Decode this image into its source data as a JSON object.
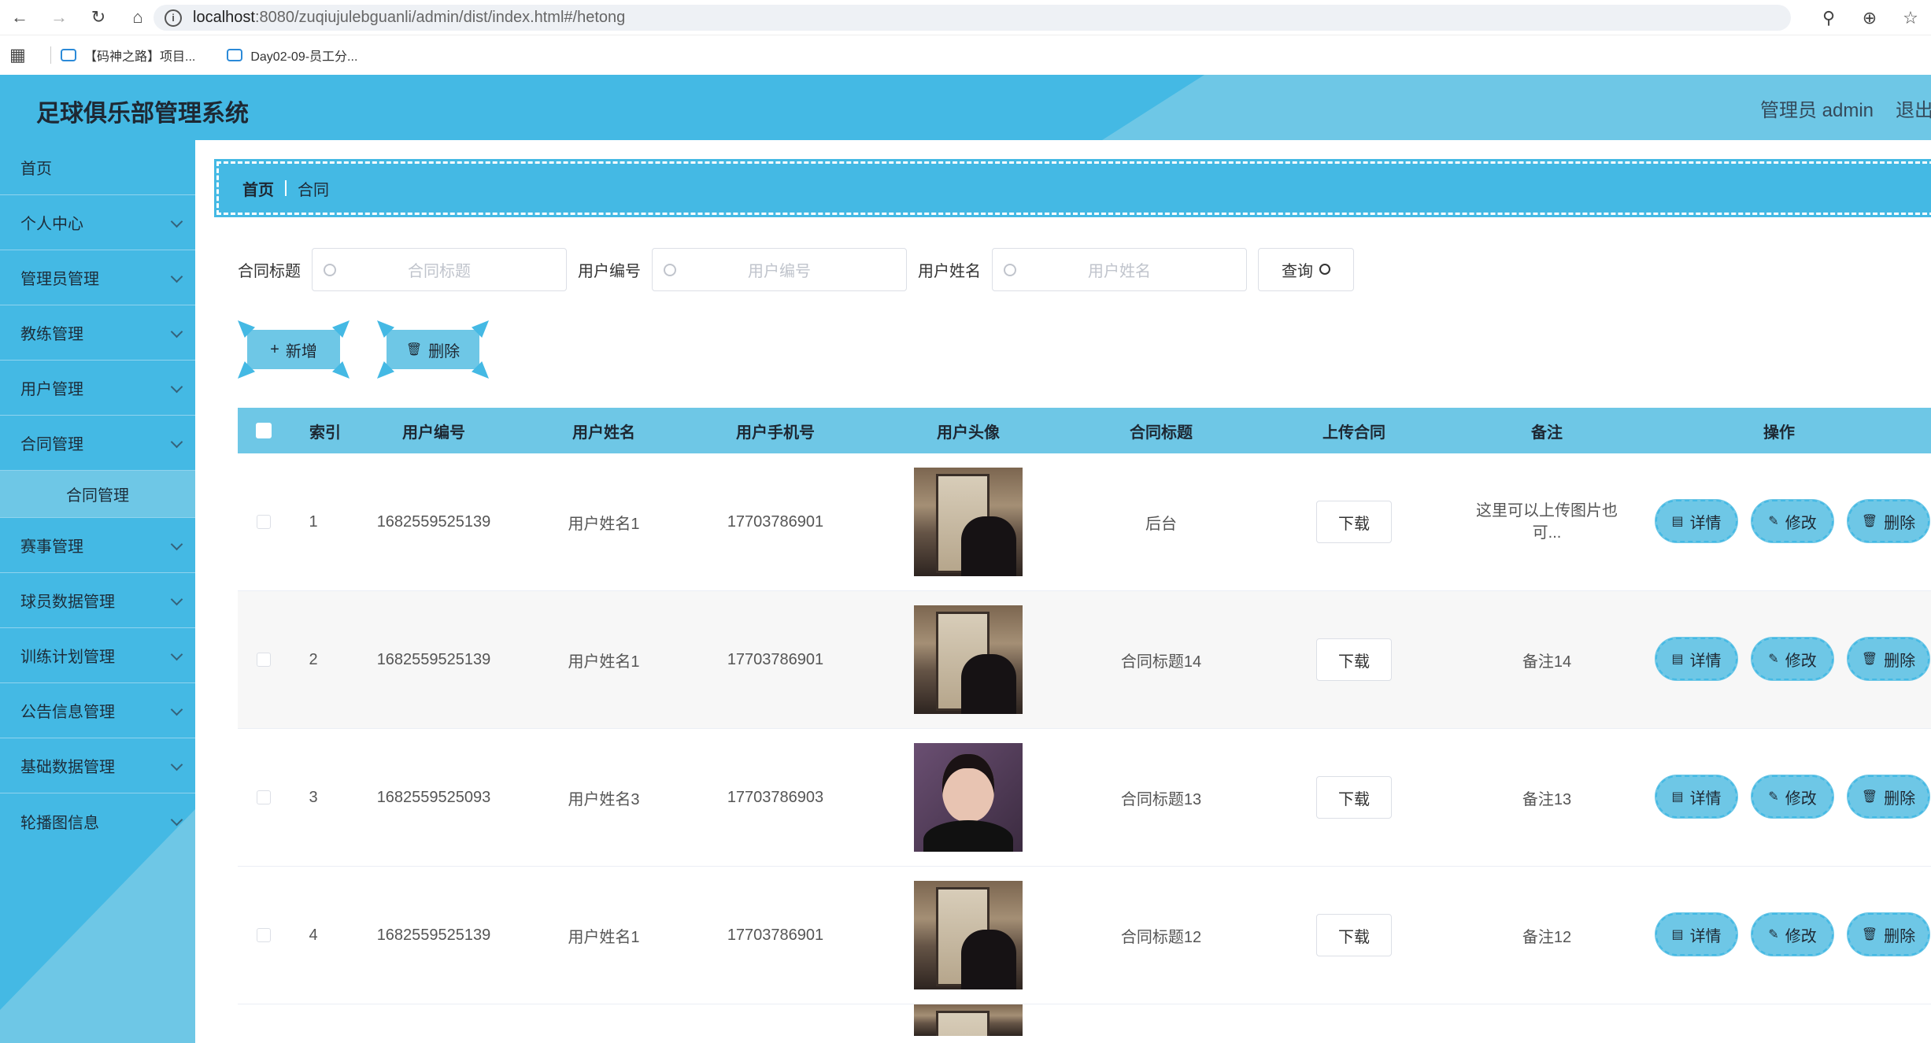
{
  "browser": {
    "url_host": "localhost",
    "url_rest": ":8080/zuqiujulebguanli/admin/dist/index.html#/hetong",
    "bookmarks": [
      "【码神之路】项目...",
      "Day02-09-员工分..."
    ]
  },
  "header": {
    "title": "足球俱乐部管理系统",
    "user": "管理员 admin",
    "logout": "退出"
  },
  "sidebar": {
    "items": [
      {
        "label": "首页"
      },
      {
        "label": "个人中心"
      },
      {
        "label": "管理员管理"
      },
      {
        "label": "教练管理"
      },
      {
        "label": "用户管理"
      },
      {
        "label": "合同管理"
      },
      {
        "label": "合同管理"
      },
      {
        "label": "赛事管理"
      },
      {
        "label": "球员数据管理"
      },
      {
        "label": "训练计划管理"
      },
      {
        "label": "公告信息管理"
      },
      {
        "label": "基础数据管理"
      },
      {
        "label": "轮播图信息"
      }
    ]
  },
  "breadcrumb": {
    "home": "首页",
    "current": "合同"
  },
  "search": {
    "f1_label": "合同标题",
    "f1_placeholder": "合同标题",
    "f2_label": "用户编号",
    "f2_placeholder": "用户编号",
    "f3_label": "用户姓名",
    "f3_placeholder": "用户姓名",
    "button": "查询"
  },
  "actions": {
    "add": "新增",
    "delete": "删除"
  },
  "table": {
    "headers": [
      "索引",
      "用户编号",
      "用户姓名",
      "用户手机号",
      "用户头像",
      "合同标题",
      "上传合同",
      "备注",
      "操作"
    ],
    "download_label": "下载",
    "ops": {
      "detail": "详情",
      "edit": "修改",
      "delete": "删除"
    },
    "rows": [
      {
        "index": "1",
        "user_no": "1682559525139",
        "name": "用户姓名1",
        "phone": "17703786901",
        "title": "后台",
        "remark": "这里可以上传图片也可..."
      },
      {
        "index": "2",
        "user_no": "1682559525139",
        "name": "用户姓名1",
        "phone": "17703786901",
        "title": "合同标题14",
        "remark": "备注14"
      },
      {
        "index": "3",
        "user_no": "1682559525093",
        "name": "用户姓名3",
        "phone": "17703786903",
        "title": "合同标题13",
        "remark": "备注13"
      },
      {
        "index": "4",
        "user_no": "1682559525139",
        "name": "用户姓名1",
        "phone": "17703786901",
        "title": "合同标题12",
        "remark": "备注12"
      }
    ]
  },
  "colors": {
    "primary": "#44b9e4",
    "accent": "#6ec7e6"
  }
}
